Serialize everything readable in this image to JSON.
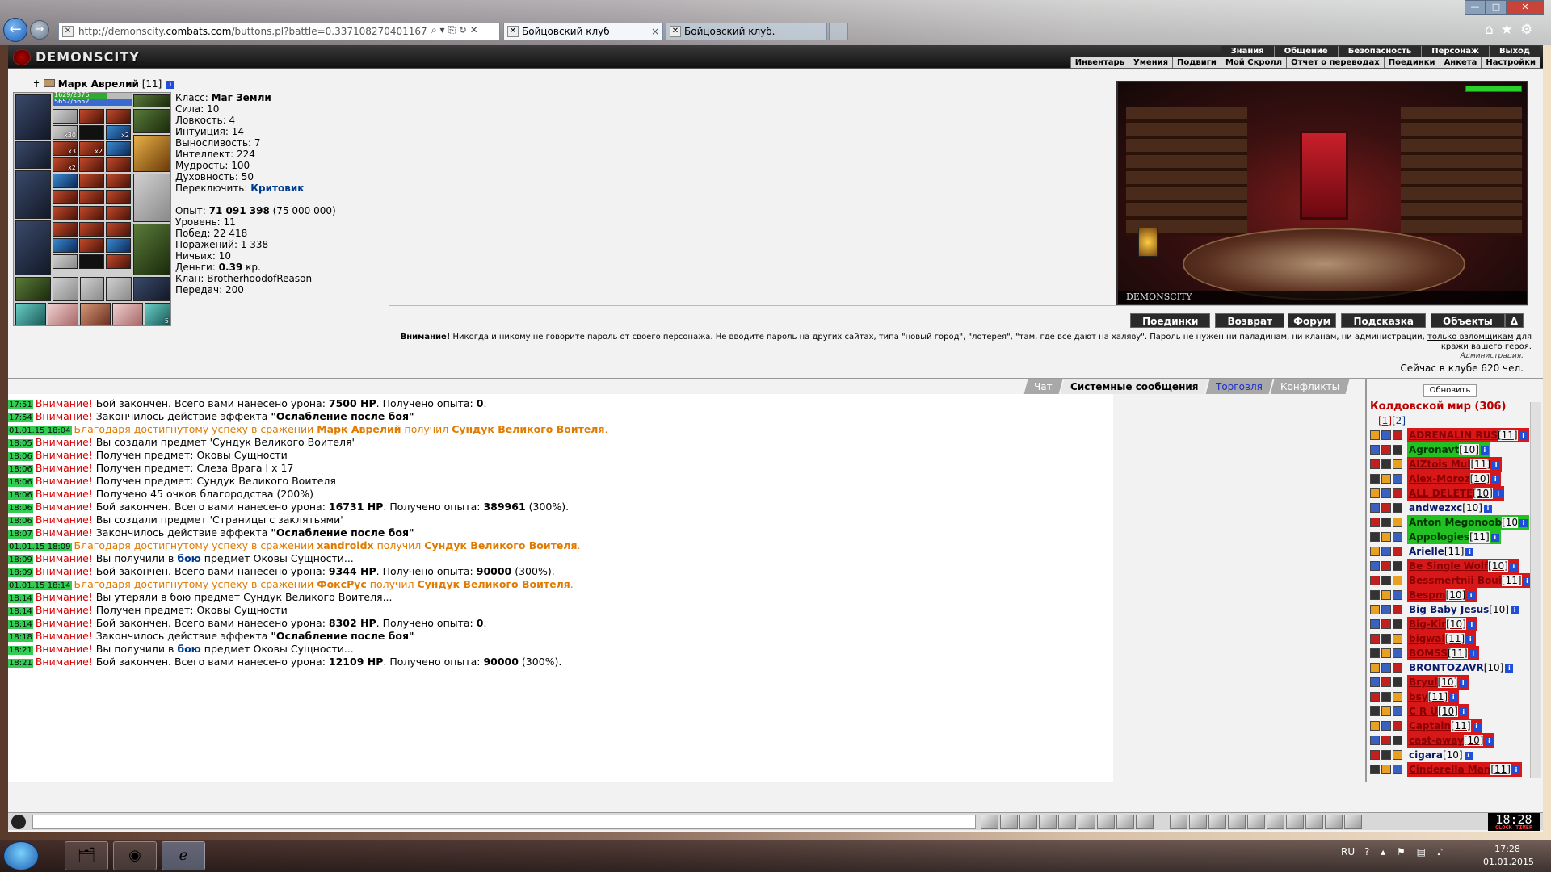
{
  "browser": {
    "url_prefix": "http://demonscity.",
    "url_domain": "combats.com",
    "url_rest": "/buttons.pl?battle=0.337108270401167",
    "tabs": [
      {
        "label": "Бойцовский клуб",
        "close": "×"
      },
      {
        "label": "Бойцовский клуб."
      }
    ],
    "back": "←",
    "forward": "→",
    "addr_tools": "⌕ ▾ ⎘ ↻ ✕",
    "window_controls": [
      "—",
      "□",
      "✕"
    ],
    "icons": "⌂★⚙"
  },
  "game": {
    "logo": "DEMONSCITY",
    "top_menu": [
      "Знания",
      "Общение",
      "Безопасность",
      "Персонаж",
      "Выход"
    ],
    "sub_menu": [
      "Инвентарь",
      "Умения",
      "Подвиги",
      "Мой Скролл",
      "Отчет о переводах",
      "Поединки",
      "Анкета",
      "Настройки"
    ],
    "character": {
      "name": "Марк Аврелий",
      "level": "[11]",
      "info": "i",
      "hp_text": "1629/2376",
      "hp_fraction": 0.686,
      "mp_text": "5652/5652",
      "slot_badges": [
        "x30",
        "x2",
        "x3",
        "x2",
        "x2",
        "5"
      ]
    },
    "stats": {
      "class_label": "Класс:",
      "class_value": "Маг Земли",
      "strength": "Сила: 10",
      "agility": "Ловкость: 4",
      "intuition": "Интуиция: 14",
      "endurance": "Выносливость: 7",
      "intellect": "Интеллект: 224",
      "wisdom": "Мудрость: 100",
      "spirit": "Духовность: 50",
      "switch_label": "Переключить:",
      "switch_value": "Критовик",
      "exp_label": "Опыт:",
      "exp_value": "71 091 398",
      "exp_next": "(75 000 000)",
      "level": "Уровень: 11",
      "wins": "Побед: 22 418",
      "losses": "Поражений: 1 338",
      "draws": "Ничьих: 10",
      "money_label": "Деньги:",
      "money_value": "0.39",
      "money_unit": "кр.",
      "clan": "Клан: BrotherhoodofReason",
      "transfers": "Передач: 200"
    },
    "room": {
      "label": "DEMONSCITY"
    },
    "action_buttons": [
      "Поединки",
      "Возврат",
      "Форум",
      "Подсказка",
      "Объекты",
      "Δ"
    ],
    "warning": {
      "bold": "Внимание!",
      "text": " Никогда и никому не говорите пароль от своего персонажа. Не вводите пароль на других сайтах, типа \"новый город\", \"лотерея\", \"там, где все дают на халяву\". Пароль не нужен ни паладинам, ни кланам, ни администрации, ",
      "link": "только взломщикам",
      "tail": " для кражи вашего героя.",
      "sign": "Администрация."
    },
    "online": "Сейчас в клубе 620 чел.",
    "chat_tabs": [
      "Чат",
      "Системные сообщения",
      "Торговля",
      "Конфликты"
    ],
    "chat": [
      {
        "t": "17:51",
        "k": "w",
        "p": [
          "Бой закончен. Всего вами нанесено урона: ",
          {
            "b": "7500 HP"
          },
          ". Получено опыта: ",
          {
            "b": "0"
          },
          "."
        ]
      },
      {
        "t": "17:54",
        "k": "w",
        "p": [
          "Закончилось действие эффекта ",
          {
            "b": "\"Ослабление после боя\""
          }
        ]
      },
      {
        "t": "01.01.15 18:04",
        "k": "a",
        "p": [
          "Благодаря достигнутому успеху в сражении ",
          {
            "b": "Марк Аврелий"
          },
          " получил ",
          {
            "b": "Сундук Великого Воителя"
          },
          "."
        ]
      },
      {
        "t": "18:05",
        "k": "w",
        "p": [
          "Вы создали предмет 'Сундук Великого Воителя'"
        ]
      },
      {
        "t": "18:06",
        "k": "w",
        "p": [
          "Получен предмет: Оковы Сущности"
        ]
      },
      {
        "t": "18:06",
        "k": "w",
        "p": [
          "Получен предмет: Слеза Врага I x 17"
        ]
      },
      {
        "t": "18:06",
        "k": "w",
        "p": [
          "Получен предмет: Сундук Великого Воителя"
        ]
      },
      {
        "t": "18:06",
        "k": "w",
        "p": [
          "Получено 45 очков благородства (200%)"
        ]
      },
      {
        "t": "18:06",
        "k": "w",
        "p": [
          "Бой закончен. Всего вами нанесено урона: ",
          {
            "b": "16731 HP"
          },
          ". Получено опыта: ",
          {
            "b": "389961"
          },
          " (300%)."
        ]
      },
      {
        "t": "18:06",
        "k": "w",
        "p": [
          "Вы создали предмет 'Страницы с заклятьями'"
        ]
      },
      {
        "t": "18:07",
        "k": "w",
        "p": [
          "Закончилось действие эффекта ",
          {
            "b": "\"Ослабление после боя\""
          }
        ]
      },
      {
        "t": "01.01.15 18:09",
        "k": "a",
        "p": [
          "Благодаря достигнутому успеху в сражении ",
          {
            "b": "xandroidx"
          },
          " получил ",
          {
            "b": "Сундук Великого Воителя"
          },
          "."
        ]
      },
      {
        "t": "18:09",
        "k": "w",
        "p": [
          "Вы получили в ",
          {
            "f": "бою"
          },
          " предмет Оковы Сущности..."
        ]
      },
      {
        "t": "18:09",
        "k": "w",
        "p": [
          "Бой закончен. Всего вами нанесено урона: ",
          {
            "b": "9344 HP"
          },
          ". Получено опыта: ",
          {
            "b": "90000"
          },
          " (300%)."
        ]
      },
      {
        "t": "01.01.15 18:14",
        "k": "a",
        "p": [
          "Благодаря достигнутому успеху в сражении ",
          {
            "b": "ФоксРус"
          },
          " получил ",
          {
            "b": "Сундук Великого Воителя"
          },
          "."
        ]
      },
      {
        "t": "18:14",
        "k": "w",
        "p": [
          "Вы утеряли в бою предмет Сундук Великого Воителя..."
        ]
      },
      {
        "t": "18:14",
        "k": "w",
        "p": [
          "Получен предмет: Оковы Сущности"
        ]
      },
      {
        "t": "18:14",
        "k": "w",
        "p": [
          "Бой закончен. Всего вами нанесено урона: ",
          {
            "b": "8302 HP"
          },
          ". Получено опыта: ",
          {
            "b": "0"
          },
          "."
        ]
      },
      {
        "t": "18:18",
        "k": "w",
        "p": [
          "Закончилось действие эффекта ",
          {
            "b": "\"Ослабление после боя\""
          }
        ]
      },
      {
        "t": "18:21",
        "k": "w",
        "p": [
          "Вы получили в ",
          {
            "f": "бою"
          },
          " предмет Оковы Сущности..."
        ]
      },
      {
        "t": "18:21",
        "k": "w",
        "p": [
          "Бой закончен. Всего вами нанесено урона: ",
          {
            "b": "12109 HP"
          },
          ". Получено опыта: ",
          {
            "b": "90000"
          },
          " (300%)."
        ]
      }
    ],
    "warn_word": "Внимание!",
    "side": {
      "refresh": "Обновить",
      "world_title": "Колдовской мир (306)",
      "page_1": "[1]",
      "page_2": "[2]",
      "players": [
        {
          "name": "ADRENALIN RUS",
          "lvl": "[11]",
          "c": "red"
        },
        {
          "name": "Agronavt",
          "lvl": "[10]",
          "c": "green"
        },
        {
          "name": "AIZtois Mul",
          "lvl": "[11]",
          "c": "red"
        },
        {
          "name": "Alex-Moroz",
          "lvl": "[10]",
          "c": "red"
        },
        {
          "name": "ALL DELETE",
          "lvl": "[10]",
          "c": "red"
        },
        {
          "name": "andwezxc",
          "lvl": "[10]",
          "c": "plain"
        },
        {
          "name": "Anton Megonoob",
          "lvl": "[10",
          "c": "green"
        },
        {
          "name": "Appologies",
          "lvl": "[11]",
          "c": "green"
        },
        {
          "name": "Arielle",
          "lvl": "[11]",
          "c": "plain"
        },
        {
          "name": "Be Single Wolf",
          "lvl": "[10]",
          "c": "red"
        },
        {
          "name": "Bessmertnii Boui",
          "lvl": "[11]",
          "c": "red"
        },
        {
          "name": "Bespm",
          "lvl": "[10]",
          "c": "red"
        },
        {
          "name": "Big Baby Jesus",
          "lvl": "[10]",
          "c": "plain"
        },
        {
          "name": "Big-Kir",
          "lvl": "[10]",
          "c": "red"
        },
        {
          "name": "bigwal",
          "lvl": "[11]",
          "c": "red"
        },
        {
          "name": "BOMSS",
          "lvl": "[11]",
          "c": "red"
        },
        {
          "name": "BRONTOZAVR",
          "lvl": "[10]",
          "c": "plain"
        },
        {
          "name": "Bryul",
          "lvl": "[10]",
          "c": "red"
        },
        {
          "name": "bsy",
          "lvl": "[11]",
          "c": "red"
        },
        {
          "name": "C R U",
          "lvl": "[10]",
          "c": "red"
        },
        {
          "name": "Captain",
          "lvl": "[11]",
          "c": "red"
        },
        {
          "name": "cast-away",
          "lvl": "[10]",
          "c": "red"
        },
        {
          "name": "cigara",
          "lvl": "[10]",
          "c": "plain"
        },
        {
          "name": "Cinderella Man",
          "lvl": "[11]",
          "c": "red"
        }
      ]
    },
    "clock": {
      "time": "18:28",
      "label": "CLOCK TIMER"
    }
  },
  "taskbar": {
    "lang": "RU",
    "time": "17:28",
    "date": "01.01.2015",
    "apps": [
      "🗂",
      "◉",
      "ℯ"
    ]
  }
}
